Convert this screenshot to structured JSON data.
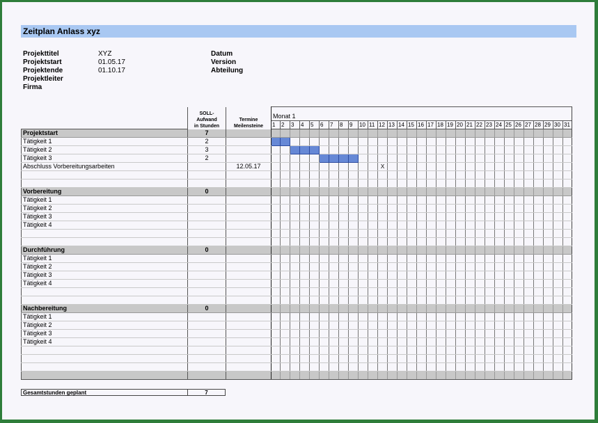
{
  "title": "Zeitplan Anlass xyz",
  "info_left": [
    {
      "label": "Projekttitel",
      "value": "XYZ"
    },
    {
      "label": "Projektstart",
      "value": "01.05.17"
    },
    {
      "label": "Projektende",
      "value": "01.10.17"
    },
    {
      "label": "Projektleiter",
      "value": ""
    },
    {
      "label": "Firma",
      "value": ""
    }
  ],
  "info_right": [
    "Datum",
    "Version",
    "Abteilung"
  ],
  "table": {
    "hours_header": "SOLL-\nAufwand\nin Stunden",
    "dates_header": "Termine\nMeilensteine",
    "month_label": "Monat 1",
    "days": [
      "1",
      "2",
      "3",
      "4",
      "5",
      "6",
      "7",
      "8",
      "9",
      "10",
      "11",
      "12",
      "13",
      "14",
      "15",
      "16",
      "17",
      "18",
      "19",
      "20",
      "21",
      "22",
      "23",
      "24",
      "25",
      "26",
      "27",
      "28",
      "29",
      "30",
      "31"
    ],
    "rows": [
      {
        "type": "section",
        "task": "Projektstart",
        "hours": "7",
        "date": ""
      },
      {
        "type": "task",
        "task": "Tätigkeit 1",
        "hours": "2",
        "date": "",
        "bar_days": [
          1,
          2
        ]
      },
      {
        "type": "task",
        "task": "Tätigkeit 2",
        "hours": "3",
        "date": "",
        "bar_days": [
          3,
          4,
          5
        ]
      },
      {
        "type": "task",
        "task": "Tätigkeit 3",
        "hours": "2",
        "date": "",
        "bar_days": [
          6,
          7,
          8,
          9
        ]
      },
      {
        "type": "task",
        "task": "Abschluss Vorbereitungsarbeiten",
        "hours": "",
        "date": "12.05.17",
        "mark_day": 12,
        "mark": "X"
      },
      {
        "type": "blank"
      },
      {
        "type": "blank"
      },
      {
        "type": "section",
        "task": "Vorbereitung",
        "hours": "0",
        "date": ""
      },
      {
        "type": "task",
        "task": "Tätigkeit 1",
        "hours": "",
        "date": ""
      },
      {
        "type": "task",
        "task": "Tätigkeit 2",
        "hours": "",
        "date": ""
      },
      {
        "type": "task",
        "task": "Tätigkeit 3",
        "hours": "",
        "date": ""
      },
      {
        "type": "task",
        "task": "Tätigkeit 4",
        "hours": "",
        "date": ""
      },
      {
        "type": "blank"
      },
      {
        "type": "blank"
      },
      {
        "type": "section",
        "task": "Durchführung",
        "hours": "0",
        "date": ""
      },
      {
        "type": "task",
        "task": "Tätigkeit 1",
        "hours": "",
        "date": ""
      },
      {
        "type": "task",
        "task": "Tätigkeit 2",
        "hours": "",
        "date": ""
      },
      {
        "type": "task",
        "task": "Tätigkeit 3",
        "hours": "",
        "date": ""
      },
      {
        "type": "task",
        "task": "Tätigkeit 4",
        "hours": "",
        "date": ""
      },
      {
        "type": "blank"
      },
      {
        "type": "blank"
      },
      {
        "type": "section",
        "task": "Nachbereitung",
        "hours": "0",
        "date": ""
      },
      {
        "type": "task",
        "task": "Tätigkeit 1",
        "hours": "",
        "date": ""
      },
      {
        "type": "task",
        "task": "Tätigkeit 2",
        "hours": "",
        "date": ""
      },
      {
        "type": "task",
        "task": "Tätigkeit 3",
        "hours": "",
        "date": ""
      },
      {
        "type": "task",
        "task": "Tätigkeit 4",
        "hours": "",
        "date": ""
      },
      {
        "type": "blank"
      },
      {
        "type": "blank"
      },
      {
        "type": "blank"
      },
      {
        "type": "section",
        "task": "",
        "hours": "",
        "date": ""
      }
    ]
  },
  "total": {
    "label": "Gesamtstunden geplant",
    "value": "7"
  },
  "colors": {
    "title_bar": "#a9c8f2",
    "gantt_bar": "#6688d6",
    "section": "#c8c8c8",
    "frame": "#2e7d3a"
  }
}
